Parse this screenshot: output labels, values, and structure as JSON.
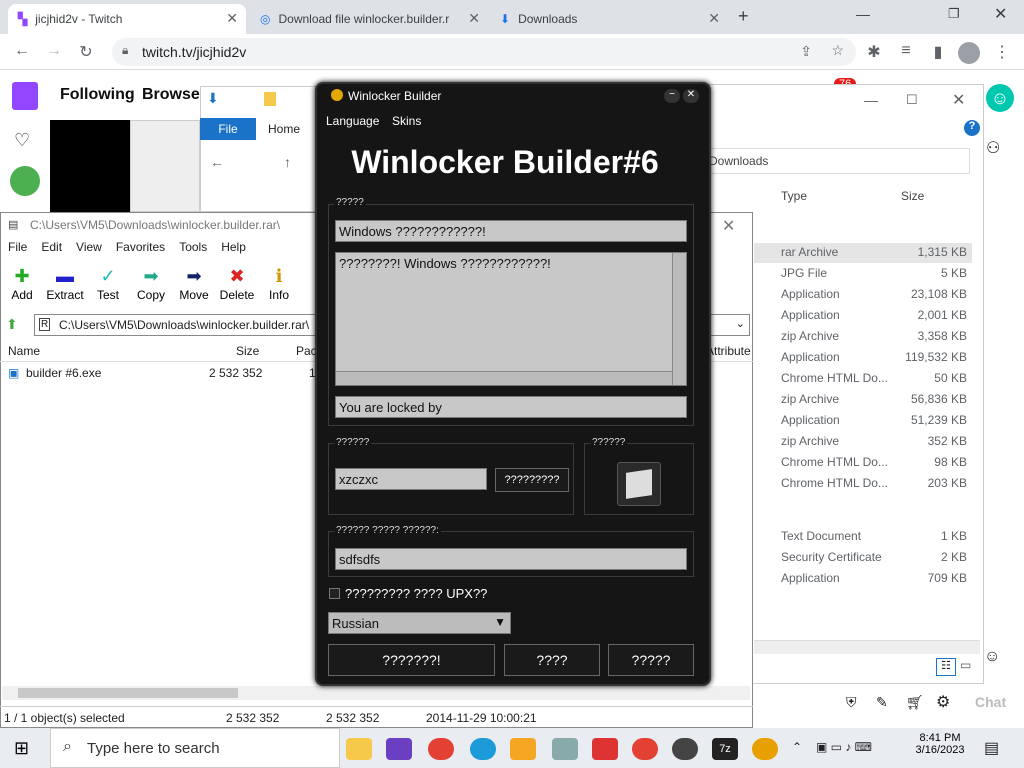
{
  "browser": {
    "tabs": [
      {
        "title": "jicjhid2v - Twitch"
      },
      {
        "title": "Download file winlocker.builder.r"
      },
      {
        "title": "Downloads"
      }
    ],
    "url": "twitch.tv/jicjhid2v"
  },
  "twitch": {
    "nav": [
      "Following",
      "Browse"
    ],
    "notif_count": "76",
    "chat_label": "Chat"
  },
  "explorer": {
    "ribbon": {
      "file": "File",
      "home": "Home"
    },
    "address": "Downloads",
    "cols": {
      "type": "Type",
      "size": "Size"
    },
    "files": [
      {
        "type": "rar Archive",
        "size": "1,315 KB"
      },
      {
        "type": "JPG File",
        "size": "5 KB"
      },
      {
        "type": "Application",
        "size": "23,108 KB"
      },
      {
        "type": "Application",
        "size": "2,001 KB"
      },
      {
        "type": "zip Archive",
        "size": "3,358 KB"
      },
      {
        "type": "Application",
        "size": "119,532 KB"
      },
      {
        "type": "Chrome HTML Do...",
        "size": "50 KB"
      },
      {
        "type": "zip Archive",
        "size": "56,836 KB"
      },
      {
        "type": "Application",
        "size": "51,239 KB"
      },
      {
        "type": "zip Archive",
        "size": "352 KB"
      },
      {
        "type": "Chrome HTML Do...",
        "size": "98 KB"
      },
      {
        "type": "Chrome HTML Do...",
        "size": "203 KB"
      },
      {
        "type": "Text Document",
        "size": "1 KB"
      },
      {
        "type": "Security Certificate",
        "size": "2 KB"
      },
      {
        "type": "Application",
        "size": "709 KB"
      }
    ]
  },
  "winrar": {
    "title": "C:\\Users\\VM5\\Downloads\\winlocker.builder.rar\\",
    "menu": [
      "File",
      "Edit",
      "View",
      "Favorites",
      "Tools",
      "Help"
    ],
    "buttons": [
      "Add",
      "Extract",
      "Test",
      "Copy",
      "Move",
      "Delete",
      "Info"
    ],
    "path": "C:\\Users\\VM5\\Downloads\\winlocker.builder.rar\\",
    "cols": {
      "name": "Name",
      "size": "Size",
      "packed": "Pac",
      "attr": "Attribute"
    },
    "row": {
      "name": "builder #6.exe",
      "size": "2 532 352",
      "packed": "1"
    },
    "status": {
      "selected": "1 / 1 object(s) selected",
      "size1": "2 532 352",
      "size2": "2 532 352",
      "date": "2014-11-29 10:00:21"
    }
  },
  "locker": {
    "window_title": "Winlocker Builder",
    "menu": [
      "Language",
      "Skins"
    ],
    "heading": "Winlocker Builder#6",
    "group1_caption": "?????",
    "title_value": "Windows ????????????!",
    "text_value": "????????! Windows ????????????!",
    "locked_value": "You are locked by",
    "group2_caption": "??????",
    "password_value": "xzczxc",
    "password_button": "?????????",
    "group3_caption": "??????",
    "group4_caption": "?????? ????? ??????:",
    "path_value": "sdfsdfs",
    "checkbox_label": "????????? ???? UPX??",
    "language_value": "Russian",
    "btn_build": "???????!",
    "btn_2": "????",
    "btn_3": "?????"
  },
  "taskbar": {
    "search_placeholder": "Type here to search",
    "time": "8:41 PM",
    "date": "3/16/2023"
  }
}
